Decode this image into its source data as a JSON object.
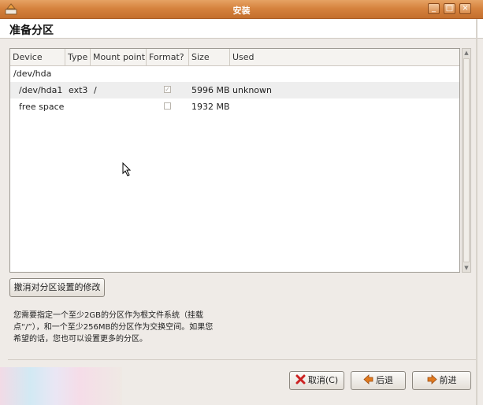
{
  "window": {
    "title": "安装",
    "icon": "installer-icon"
  },
  "page": {
    "heading": "准备分区"
  },
  "table": {
    "columns": [
      "Device",
      "Type",
      "Mount point",
      "Format?",
      "Size",
      "Used"
    ],
    "rows": [
      {
        "device": "/dev/hda",
        "type": "",
        "mount": "",
        "format": null,
        "size": "",
        "used": ""
      },
      {
        "device": "/dev/hda1",
        "type": "ext3",
        "mount": "/",
        "format": true,
        "size": "5996 MB",
        "used": "unknown"
      },
      {
        "device": "free space",
        "type": "",
        "mount": "",
        "format": false,
        "size": "1932 MB",
        "used": ""
      }
    ]
  },
  "buttons": {
    "undo": "撤消对分区设置的修改",
    "cancel": "取消(C)",
    "back": "后退",
    "forward": "前进"
  },
  "info_text": {
    "line1": "您需要指定一个至少2GB的分区作为根文件系统（挂载",
    "line2": "点“/”），和一个至少256MB的分区作为交换空间。如果您",
    "line3": "希望的话，您也可以设置更多的分区。"
  },
  "colors": {
    "titlebar": "#d6833f",
    "cancel_icon": "#cc2222",
    "nav_icon": "#e07a1f"
  }
}
